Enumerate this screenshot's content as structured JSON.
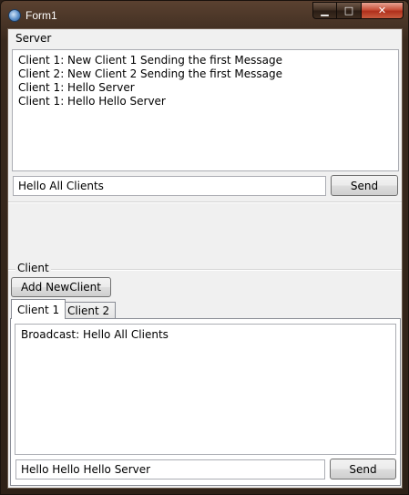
{
  "window": {
    "title": "Form1"
  },
  "caption": {
    "minimize": "▁",
    "maximize": "□",
    "close": "✕"
  },
  "server": {
    "group_label": "Server",
    "messages": [
      "Client 1:  New Client 1 Sending the first Message",
      "Client 2:  New Client 2 Sending the first Message",
      "Client 1:  Hello Server",
      "Client 1:  Hello Hello Server"
    ],
    "input_value": "Hello All Clients",
    "send_label": "Send"
  },
  "client": {
    "group_label": "Client",
    "add_button_label": "Add NewClient",
    "tabs": [
      {
        "label": "Client 1",
        "active": true
      },
      {
        "label": "Client 2",
        "active": false
      }
    ],
    "messages": [
      "Broadcast: Hello All Clients"
    ],
    "input_value": "Hello Hello Hello Server",
    "send_label": "Send"
  },
  "icons": {
    "app": "app-icon"
  },
  "colors": {
    "frame": "#3a2a1e",
    "close_button": "#c8503a",
    "form_background": "#f0f0f0"
  }
}
